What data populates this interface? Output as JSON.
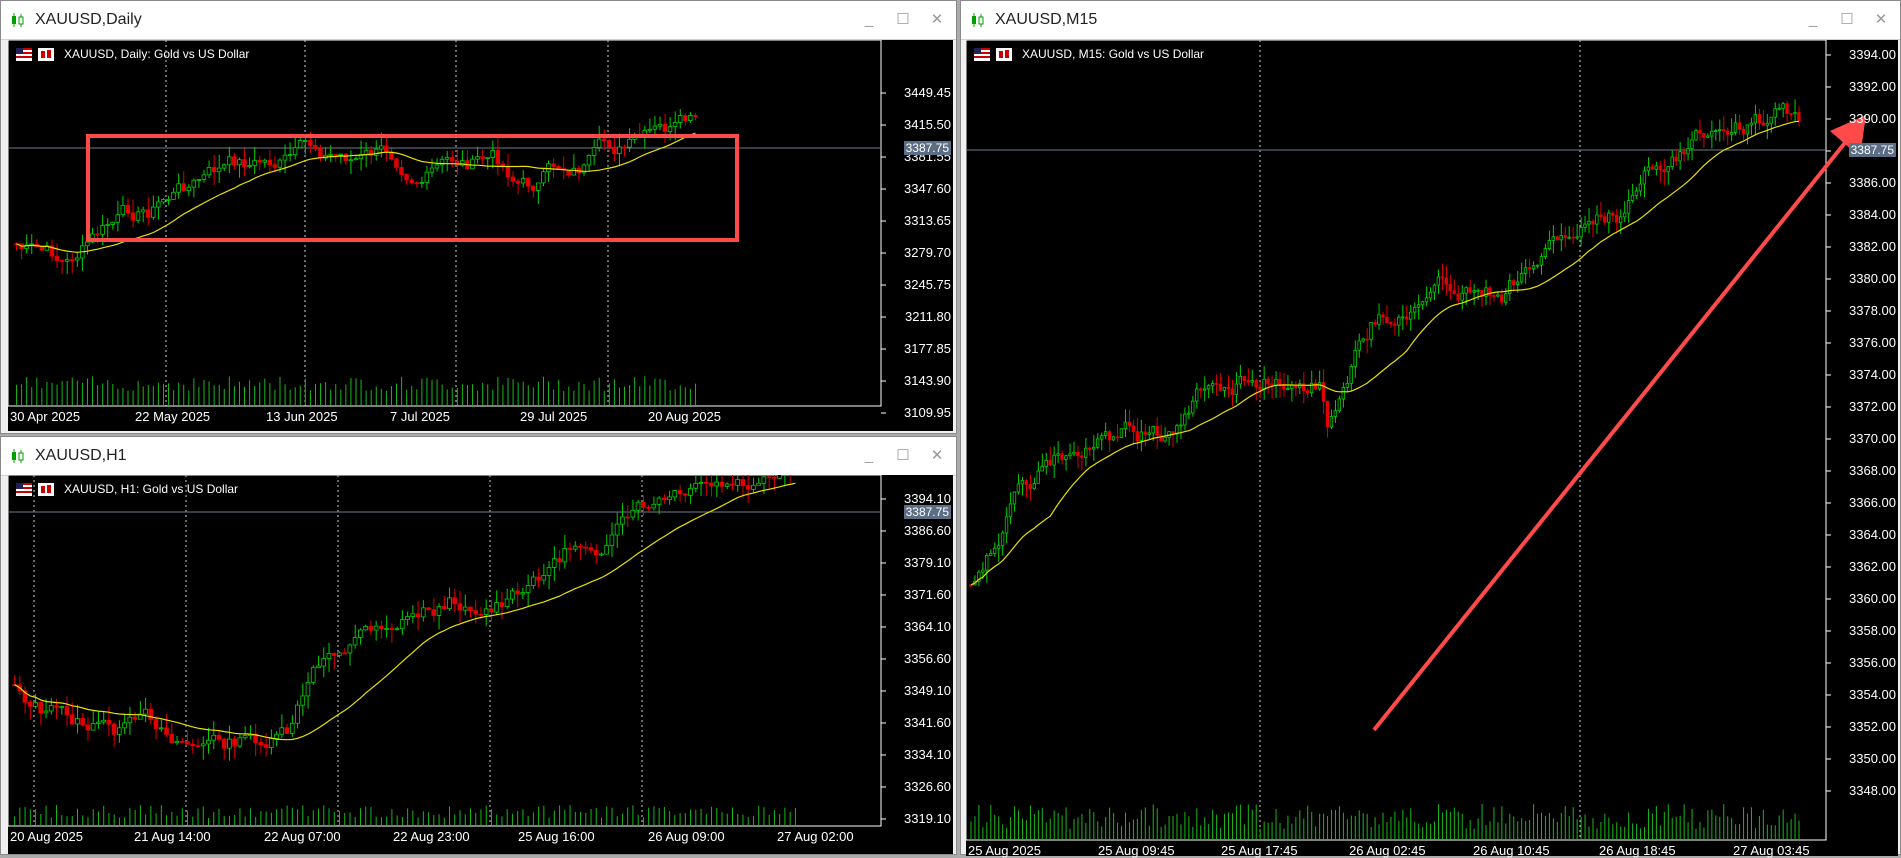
{
  "windows": {
    "daily": {
      "title": "XAUUSD,Daily",
      "legend": "XAUUSD, Daily:  Gold vs US Dollar",
      "y_ticks": [
        "3449.45",
        "3415.50",
        "3381.55",
        "3347.60",
        "3313.65",
        "3279.70",
        "3245.75",
        "3211.80",
        "3177.85",
        "3143.90",
        "3109.95"
      ],
      "x_ticks": [
        "30 Apr 2025",
        "22 May 2025",
        "13 Jun 2025",
        "7 Jul 2025",
        "29 Jul 2025",
        "20 Aug 2025"
      ],
      "price_tag": "3387.75"
    },
    "h1": {
      "title": "XAUUSD,H1",
      "legend": "XAUUSD, H1:  Gold vs US Dollar",
      "y_ticks": [
        "3394.10",
        "3386.60",
        "3379.10",
        "3371.60",
        "3364.10",
        "3356.60",
        "3349.10",
        "3341.60",
        "3334.10",
        "3326.60",
        "3319.10"
      ],
      "x_ticks": [
        "20 Aug 2025",
        "21 Aug 14:00",
        "22 Aug 07:00",
        "22 Aug 23:00",
        "25 Aug 16:00",
        "26 Aug 09:00",
        "27 Aug 02:00"
      ],
      "price_tag": "3387.75"
    },
    "m15": {
      "title": "XAUUSD,M15",
      "legend": "XAUUSD, M15:  Gold vs US Dollar",
      "y_ticks": [
        "3394.00",
        "3392.00",
        "3390.00",
        "3388.00",
        "3386.00",
        "3384.00",
        "3382.00",
        "3380.00",
        "3378.00",
        "3376.00",
        "3374.00",
        "3372.00",
        "3370.00",
        "3368.00",
        "3366.00",
        "3364.00",
        "3362.00",
        "3360.00",
        "3358.00",
        "3356.00",
        "3354.00",
        "3352.00",
        "3350.00",
        "3348.00"
      ],
      "x_ticks": [
        "25 Aug 2025",
        "25 Aug 09:45",
        "25 Aug 17:45",
        "26 Aug 02:45",
        "26 Aug 10:45",
        "26 Aug 18:45",
        "27 Aug 03:45"
      ],
      "price_tag": "3387.75"
    }
  },
  "buttons": {
    "minimize": "_",
    "maximize": "☐",
    "close": "✕"
  },
  "colors": {
    "bull": "#00d000",
    "bear": "#e00000",
    "ma": "#e8e000",
    "annotation": "#ff4a4a",
    "volume": "#18b818",
    "tag": "#5c6e86"
  },
  "icons": {
    "title": "candlestick-chart-icon",
    "legend_flag": "us-flag-icon",
    "legend_chart": "chart-type-icon"
  }
}
